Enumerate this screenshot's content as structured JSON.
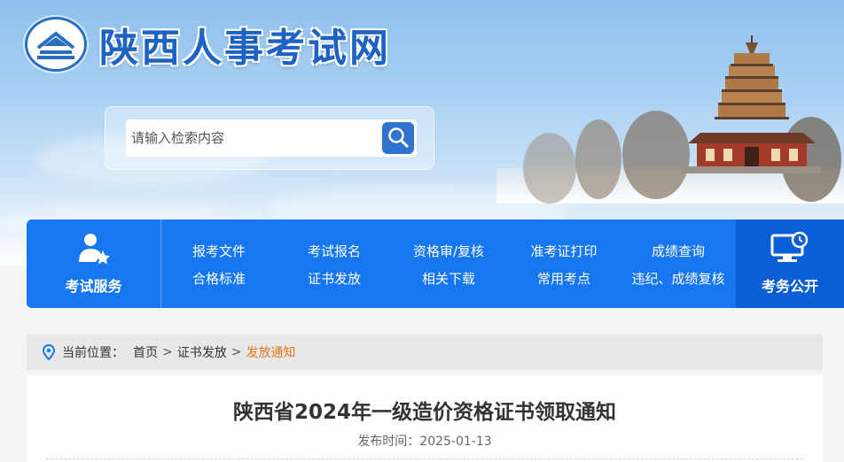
{
  "header": {
    "site_title": "陕西人事考试网",
    "search_placeholder": "请输入检索内容"
  },
  "nav": {
    "left_label": "考试服务",
    "right_label": "考务公开",
    "links": [
      "报考文件",
      "考试报名",
      "资格审/复核",
      "准考证打印",
      "成绩查询",
      "合格标准",
      "证书发放",
      "相关下载",
      "常用考点",
      "违纪、成绩复核"
    ]
  },
  "breadcrumb": {
    "prefix": "当前位置：",
    "items": [
      "首页",
      "证书发放"
    ],
    "current": "发放通知",
    "separator": ">"
  },
  "article": {
    "title": "陕西省2024年一级造价资格证书领取通知",
    "meta_label": "发布时间：",
    "date": "2025-01-13"
  },
  "colors": {
    "nav_blue": "#1677f0",
    "nav_dark": "#0a5fd6",
    "title_blue": "#1e63c4",
    "breadcrumb_current": "#e0781b"
  }
}
